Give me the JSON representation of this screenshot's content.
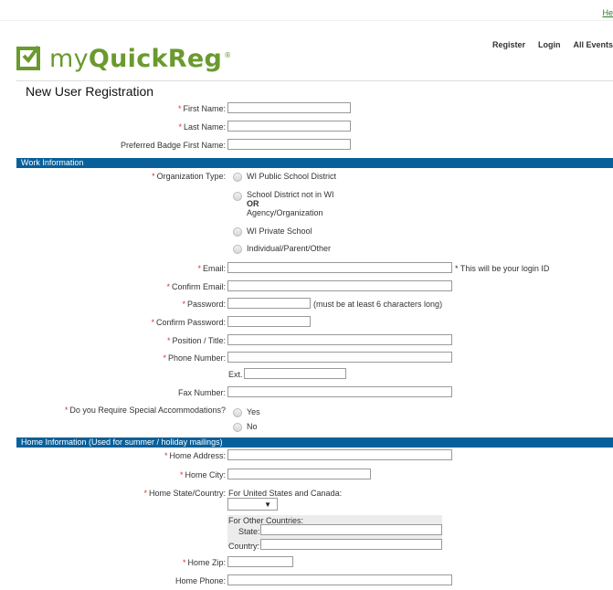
{
  "top": {
    "link": "He"
  },
  "brand": {
    "logo_my": "my",
    "logo_quick": "QuickReg",
    "tm": "®"
  },
  "nav": {
    "register": "Register",
    "login": "Login",
    "all_events": "All Events"
  },
  "page": {
    "title": "New User Registration"
  },
  "fields": {
    "first_name": "First Name:",
    "last_name": "Last Name:",
    "badge_name": "Preferred Badge First Name:",
    "org_type": "Organization Type:",
    "email": "Email:",
    "email_note": "* This will be your login ID",
    "confirm_email": "Confirm Email:",
    "password": "Password:",
    "password_note": "(must be at least 6 characters long)",
    "confirm_password": "Confirm Password:",
    "position": "Position / Title:",
    "phone": "Phone Number:",
    "ext": "Ext.",
    "fax": "Fax Number:",
    "special": "Do you Require Special Accommodations?",
    "home_address": "Home Address:",
    "home_city": "Home City:",
    "home_state": "Home State/Country:",
    "us_canada": "For United States and Canada:",
    "other_countries": "For Other Countries:",
    "state": "State:",
    "country": "Country:",
    "home_zip": "Home Zip:",
    "home_phone": "Home Phone:"
  },
  "sections": {
    "work": "Work Information",
    "home": "Home Information (Used for summer / holiday mailings)"
  },
  "org_options": {
    "o1": "WI Public School District",
    "o2_line1": "School District not in WI",
    "o2_line2": "OR",
    "o2_line3": "Agency/Organization",
    "o3": "WI Private School",
    "o4": "Individual/Parent/Other"
  },
  "special_options": {
    "yes": "Yes",
    "no": "No"
  },
  "required_mark": "*",
  "select_arrow": "▼"
}
